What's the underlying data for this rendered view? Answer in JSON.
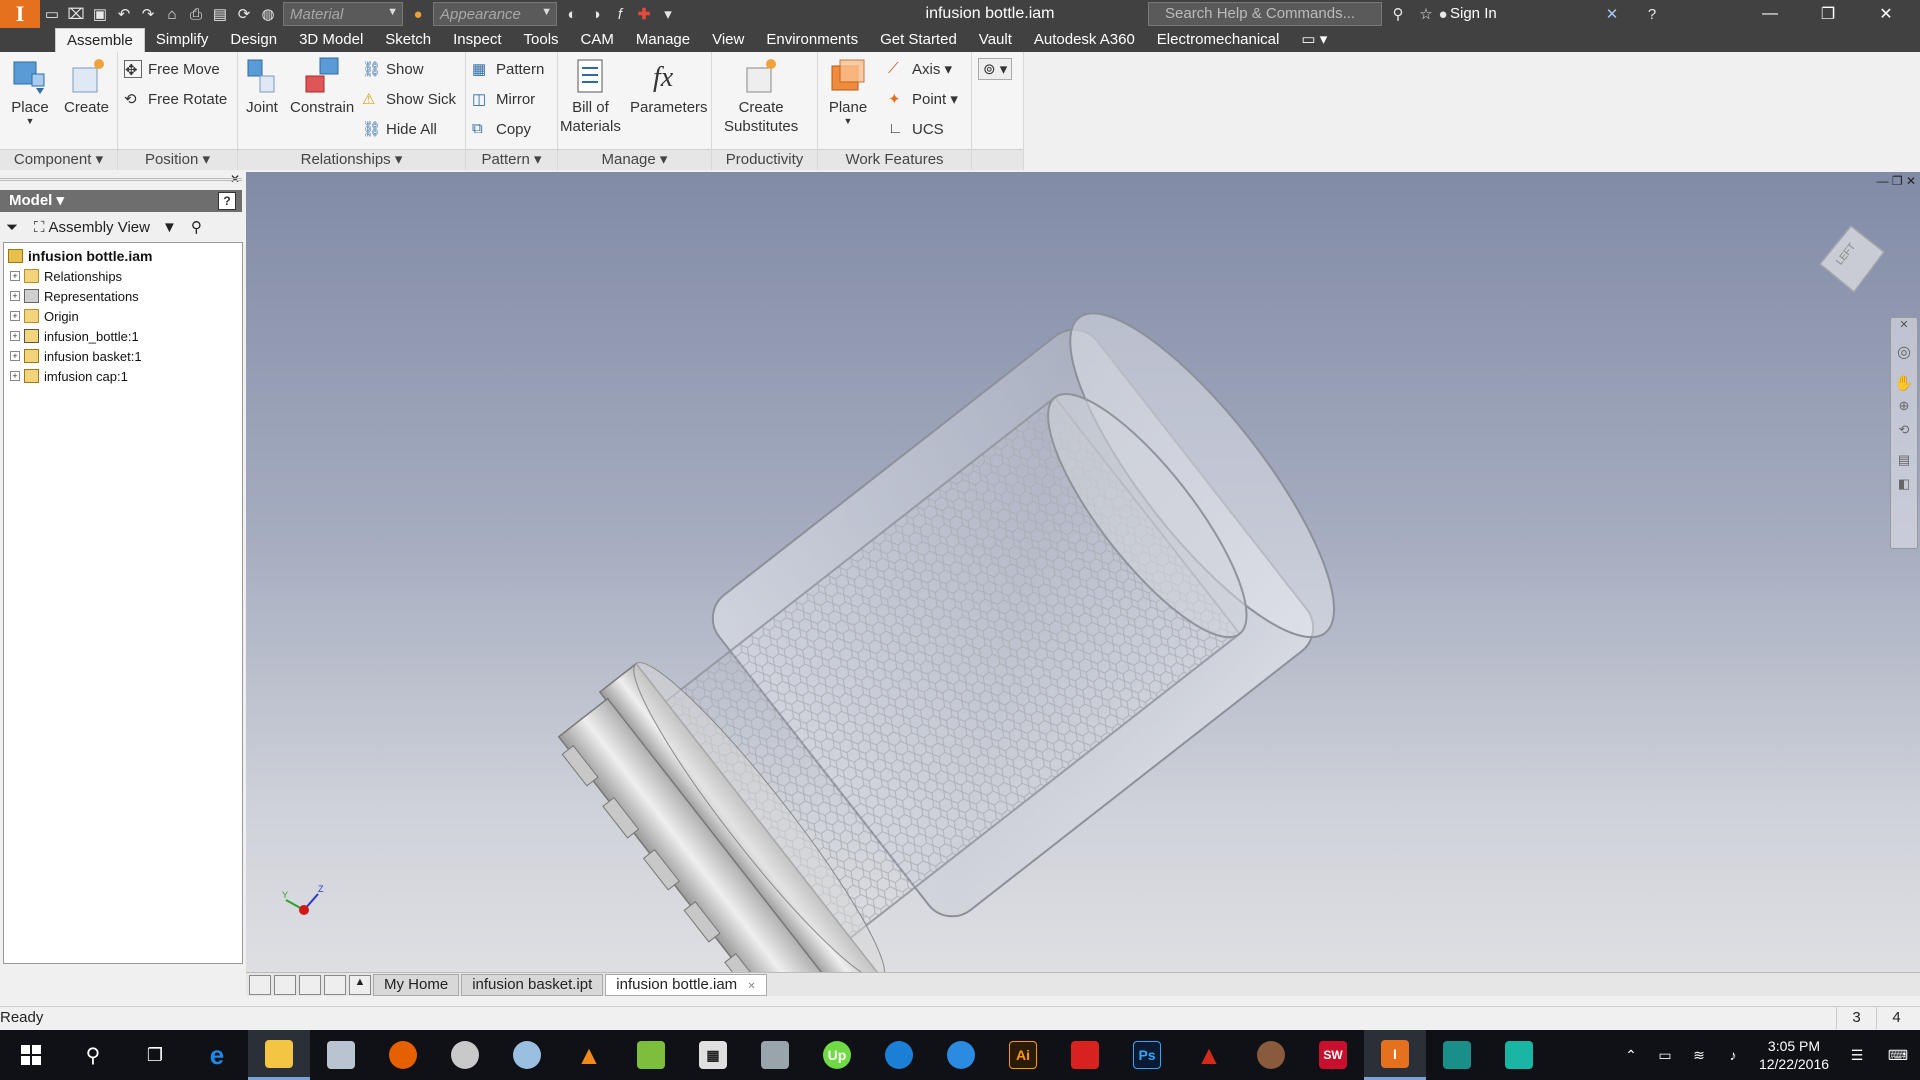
{
  "titlebar": {
    "app_logo": "I",
    "material_placeholder": "Material",
    "appearance_placeholder": "Appearance",
    "document_title": "infusion bottle.iam",
    "search_placeholder": "Search Help & Commands...",
    "sign_in": "Sign In"
  },
  "ribbon_tabs": [
    "Assemble",
    "Simplify",
    "Design",
    "3D Model",
    "Sketch",
    "Inspect",
    "Tools",
    "CAM",
    "Manage",
    "View",
    "Environments",
    "Get Started",
    "Vault",
    "Autodesk A360",
    "Electromechanical"
  ],
  "ribbon": {
    "component": {
      "title": "Component",
      "place": "Place",
      "create": "Create"
    },
    "position": {
      "title": "Position",
      "free_move": "Free Move",
      "free_rotate": "Free Rotate"
    },
    "relationships": {
      "title": "Relationships",
      "joint": "Joint",
      "constrain": "Constrain",
      "show": "Show",
      "show_sick": "Show Sick",
      "hide_all": "Hide All"
    },
    "pattern": {
      "title": "Pattern",
      "pattern": "Pattern",
      "mirror": "Mirror",
      "copy": "Copy"
    },
    "manage": {
      "title": "Manage",
      "bom_line1": "Bill of",
      "bom_line2": "Materials",
      "parameters": "Parameters"
    },
    "productivity": {
      "title": "Productivity",
      "create_line1": "Create",
      "create_line2": "Substitutes"
    },
    "work_features": {
      "title": "Work Features",
      "plane": "Plane",
      "axis": "Axis",
      "point": "Point",
      "ucs": "UCS"
    }
  },
  "browser": {
    "header": "Model",
    "view_mode": "Assembly View",
    "tree": [
      {
        "label": "infusion bottle.iam",
        "root": true
      },
      {
        "label": "Relationships",
        "icon": "folder"
      },
      {
        "label": "Representations",
        "icon": "representations"
      },
      {
        "label": "Origin",
        "icon": "folder"
      },
      {
        "label": "infusion_bottle:1",
        "icon": "part-grounded"
      },
      {
        "label": "infusion basket:1",
        "icon": "part"
      },
      {
        "label": "imfusion cap:1",
        "icon": "part"
      }
    ]
  },
  "doc_tabs": [
    "My Home",
    "infusion basket.ipt",
    "infusion bottle.iam"
  ],
  "status": {
    "text": "Ready",
    "count1": "3",
    "count2": "4"
  },
  "viewcube_label": "LEFT",
  "clock": {
    "time": "3:05 PM",
    "date": "12/22/2016"
  },
  "taskbar_apps": [
    "start",
    "search",
    "task-view",
    "edge",
    "file-explorer",
    "app-6",
    "firefox",
    "app-8",
    "app-9",
    "vlc",
    "app-11",
    "calculator",
    "app-13",
    "upwork",
    "app-15",
    "app-16",
    "illustrator",
    "acrobat",
    "photoshop",
    "autocad",
    "app-21",
    "solidworks",
    "inventor",
    "app-24",
    "app-25"
  ],
  "colors": {
    "accent": "#e5701e",
    "titlebar": "#414141",
    "viewport_top": "#828ba6",
    "viewport_bottom": "#dedfe3"
  }
}
